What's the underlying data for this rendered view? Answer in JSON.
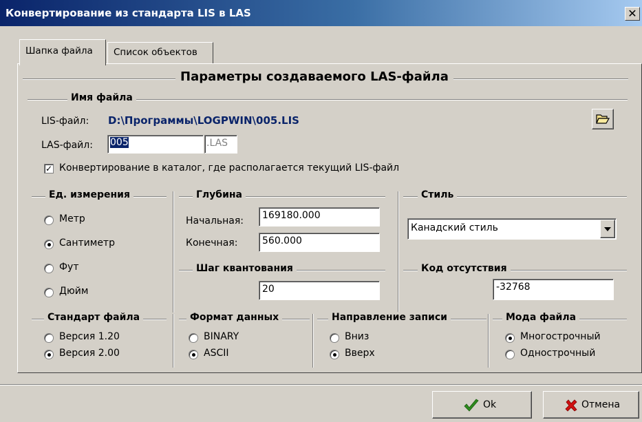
{
  "window": {
    "title": "Конвертирование из стандарта LIS в LAS",
    "close_label": "✕"
  },
  "tabs": [
    {
      "label": "Шапка файла",
      "active": true
    },
    {
      "label": "Список объектов",
      "active": false
    }
  ],
  "header": {
    "title": "Параметры создаваемого LAS-файла"
  },
  "filename": {
    "group_title": "Имя файла",
    "lis_label": "LIS-файл:",
    "lis_path": "D:\\Программы\\LOGPWIN\\005.LIS",
    "las_label": "LAS-файл:",
    "las_value": "005",
    "las_ext": ".LAS",
    "browse_icon": "folder-open-icon"
  },
  "convert_to_dir": {
    "label": "Конвертирование в каталог, где располагается текущий LIS-файл",
    "checked": true
  },
  "units": {
    "title": "Ед. измерения",
    "options": [
      {
        "label": "Метр",
        "selected": false
      },
      {
        "label": "Сантиметр",
        "selected": true
      },
      {
        "label": "Фут",
        "selected": false
      },
      {
        "label": "Дюйм",
        "selected": false
      }
    ]
  },
  "depth": {
    "title": "Глубина",
    "start_label": "Начальная:",
    "start_value": "169180.000",
    "end_label": "Конечная:",
    "end_value": "560.000"
  },
  "step": {
    "title": "Шаг квантования",
    "value": "20"
  },
  "style": {
    "title": "Стиль",
    "selected": "Канадский стиль"
  },
  "null_code": {
    "title": "Код отсутствия",
    "value": "-32768"
  },
  "file_standard": {
    "title": "Стандарт файла",
    "options": [
      {
        "label": "Версия 1.20",
        "selected": false
      },
      {
        "label": "Версия 2.00",
        "selected": true
      }
    ]
  },
  "data_format": {
    "title": "Формат данных",
    "options": [
      {
        "label": "BINARY",
        "selected": false
      },
      {
        "label": "ASCII",
        "selected": true
      }
    ]
  },
  "direction": {
    "title": "Направление записи",
    "options": [
      {
        "label": "Вниз",
        "selected": false
      },
      {
        "label": "Вверх",
        "selected": true
      }
    ]
  },
  "file_mode": {
    "title": "Мода файла",
    "options": [
      {
        "label": "Многострочный",
        "selected": true
      },
      {
        "label": "Однострочный",
        "selected": false
      }
    ]
  },
  "buttons": {
    "ok_label": "Ok",
    "ok_icon": "checkmark-icon",
    "cancel_label": "Отмена",
    "cancel_icon": "cross-icon"
  },
  "colors": {
    "path": "#0a246a",
    "ok_check": "#2e8b1e",
    "cancel_cross": "#d01010"
  }
}
